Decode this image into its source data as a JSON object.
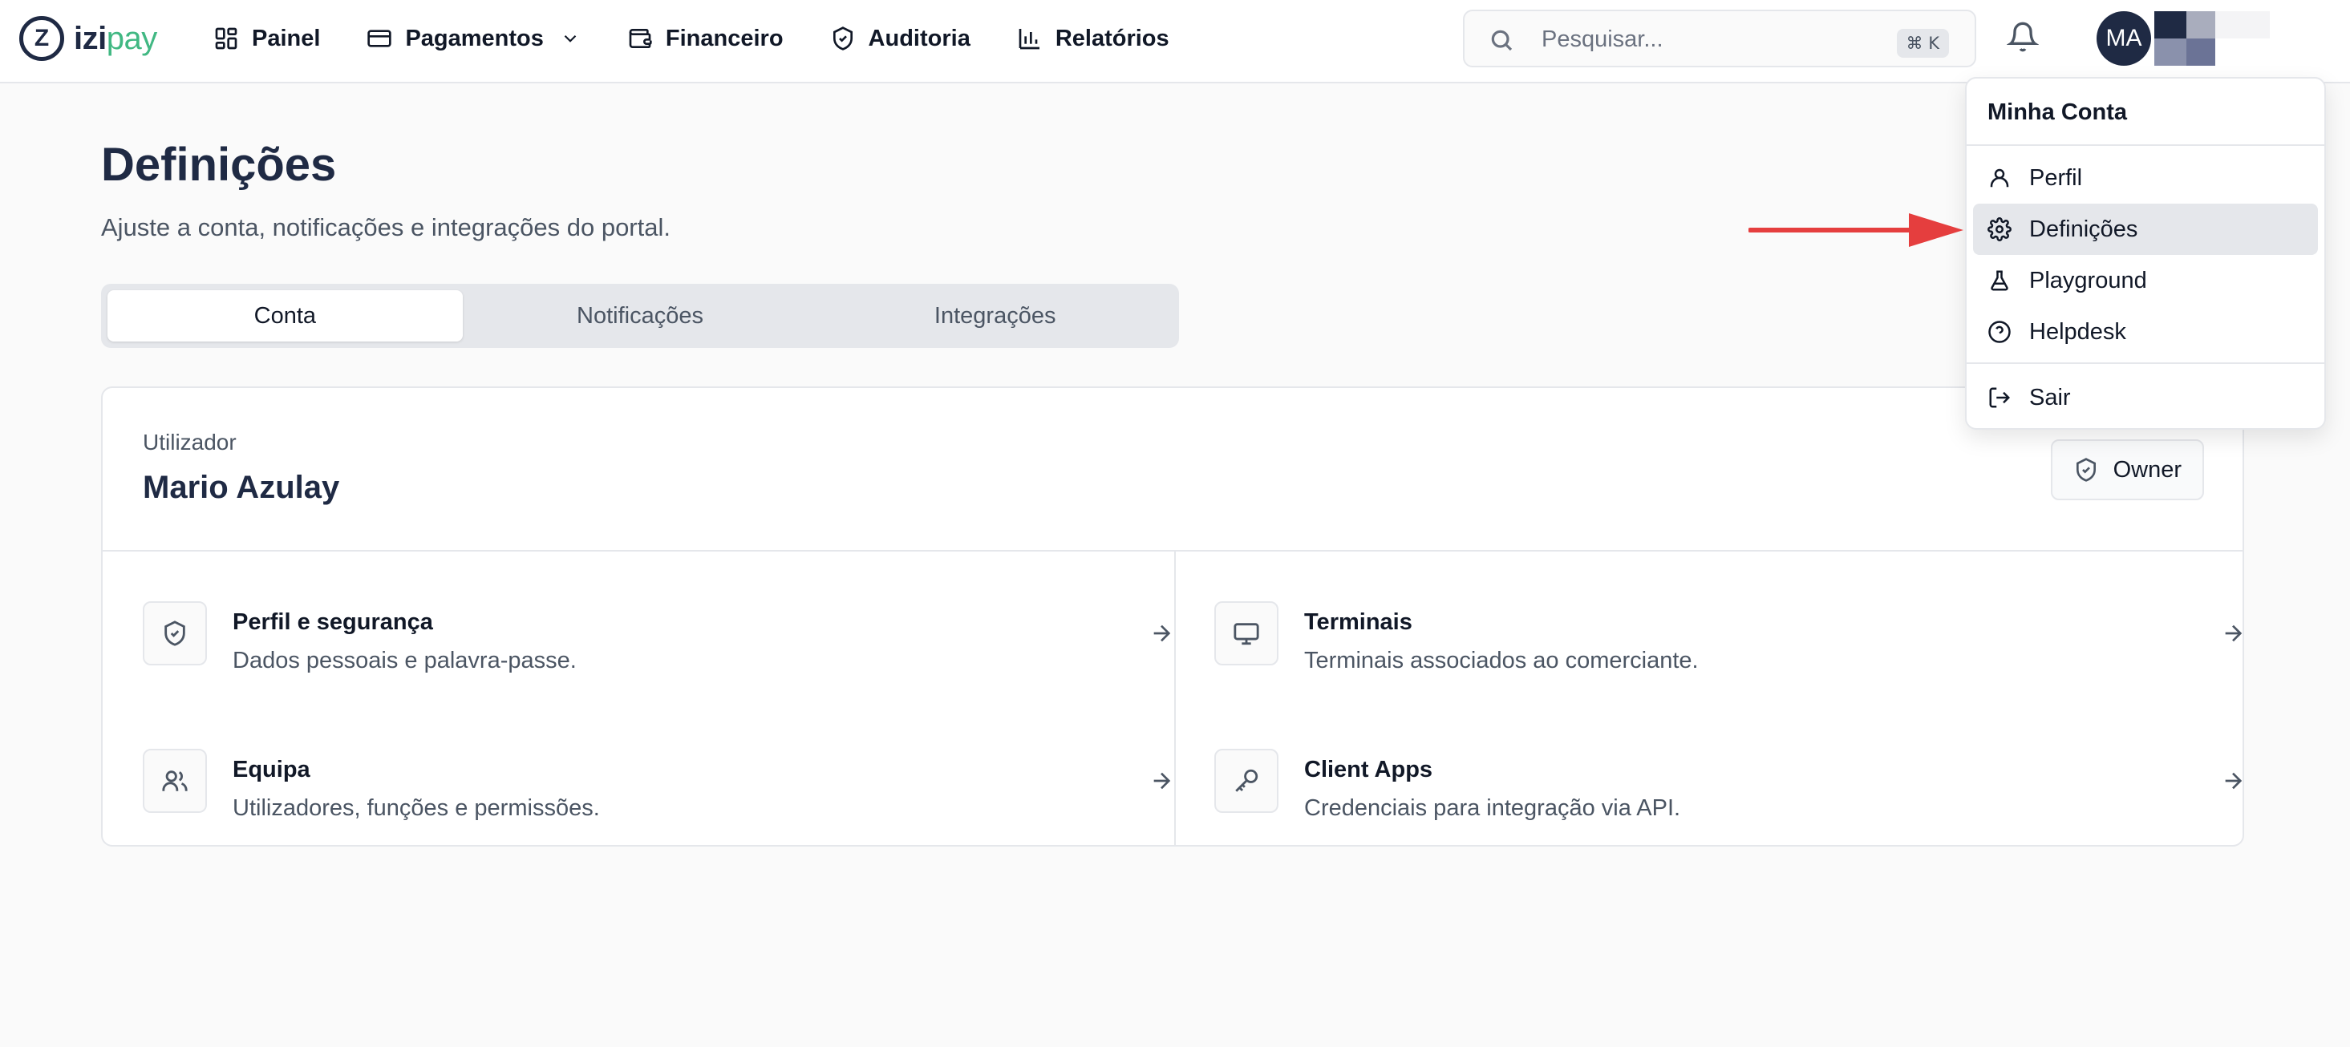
{
  "app": {
    "logo_primary": "izi",
    "logo_secondary": "pay"
  },
  "nav": {
    "items": [
      {
        "label": "Painel",
        "icon": "dashboard-icon"
      },
      {
        "label": "Pagamentos",
        "icon": "credit-card-icon",
        "has_dropdown": true
      },
      {
        "label": "Financeiro",
        "icon": "wallet-icon"
      },
      {
        "label": "Auditoria",
        "icon": "shield-check-icon"
      },
      {
        "label": "Relatórios",
        "icon": "bar-chart-icon"
      }
    ]
  },
  "search": {
    "placeholder": "Pesquisar...",
    "shortcut": "⌘ K"
  },
  "user": {
    "initials": "MA"
  },
  "page": {
    "title": "Definições",
    "subtitle": "Ajuste a conta, notificações e integrações do portal."
  },
  "tabs": [
    {
      "label": "Conta",
      "active": true
    },
    {
      "label": "Notificações",
      "active": false
    },
    {
      "label": "Integrações",
      "active": false
    }
  ],
  "account_card": {
    "user_label": "Utilizador",
    "user_name": "Mario Azulay",
    "role_badge": "Owner",
    "tiles": [
      {
        "title": "Perfil e segurança",
        "description": "Dados pessoais e palavra-passe.",
        "icon": "shield-icon"
      },
      {
        "title": "Terminais",
        "description": "Terminais associados ao comerciante.",
        "icon": "monitor-icon"
      },
      {
        "title": "Equipa",
        "description": "Utilizadores, funções e permissões.",
        "icon": "users-icon"
      },
      {
        "title": "Client Apps",
        "description": "Credenciais para integração via API.",
        "icon": "key-icon"
      }
    ]
  },
  "account_menu": {
    "header": "Minha Conta",
    "items": [
      {
        "label": "Perfil",
        "icon": "user-icon"
      },
      {
        "label": "Definições",
        "icon": "gear-icon",
        "highlighted": true
      },
      {
        "label": "Playground",
        "icon": "flask-icon"
      },
      {
        "label": "Helpdesk",
        "icon": "help-circle-icon"
      },
      {
        "label": "Sair",
        "icon": "logout-icon"
      }
    ]
  },
  "colors": {
    "brand_dark": "#1f2a44",
    "brand_green": "#41b883",
    "annotation_red": "#e53e3e"
  }
}
